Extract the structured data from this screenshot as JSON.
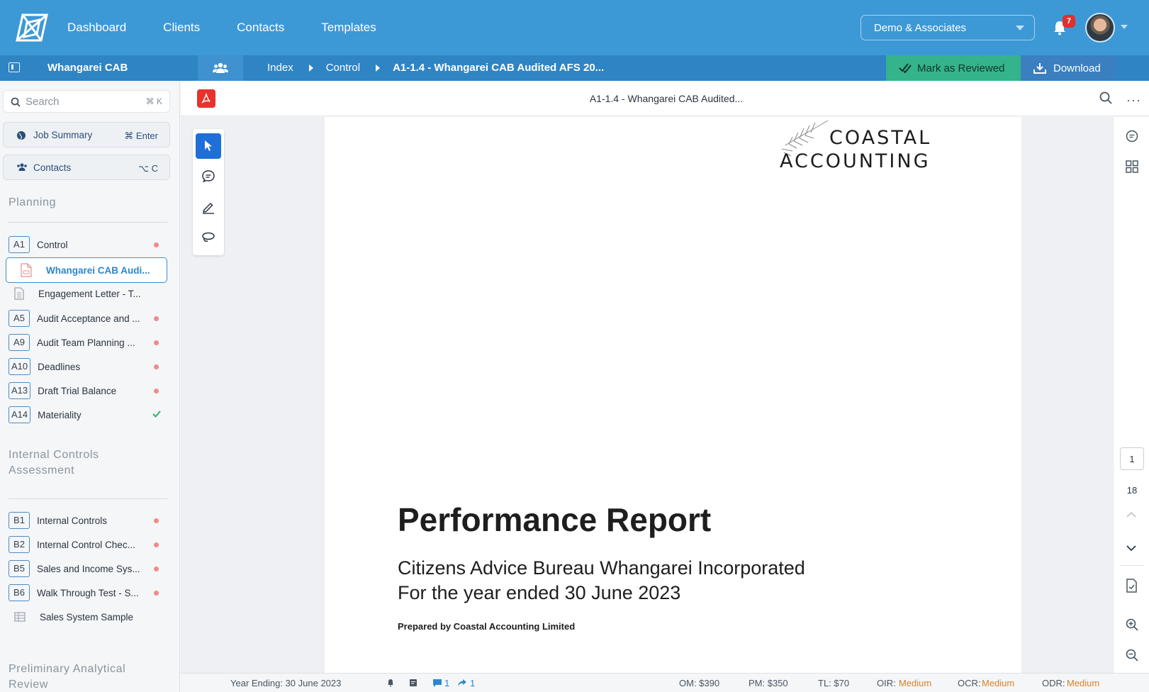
{
  "nav": {
    "items": [
      "Dashboard",
      "Clients",
      "Contacts",
      "Templates"
    ],
    "org_selector": "Demo & Associates",
    "notifications_count": "7"
  },
  "subbar": {
    "client": "Whangarei CAB",
    "breadcrumb": [
      "Index",
      "Control",
      "A1-1.4 - Whangarei CAB Audited AFS 20..."
    ],
    "mark_reviewed": "Mark as Reviewed",
    "download": "Download"
  },
  "sidebar": {
    "search_placeholder": "Search",
    "search_shortcut": "⌘ K",
    "job_summary": {
      "label": "Job Summary",
      "shortcut": "⌘ Enter"
    },
    "contacts": {
      "label": "Contacts",
      "shortcut": "⌥ C"
    },
    "sections": [
      {
        "title": "Planning",
        "items": [
          {
            "code": "A1",
            "label": "Control",
            "status": "pending"
          },
          {
            "code": "",
            "label": "Whangarei CAB Audi...",
            "type": "pdf",
            "active": true
          },
          {
            "code": "",
            "label": "Engagement Letter - T...",
            "type": "doc"
          },
          {
            "code": "A5",
            "label": "Audit Acceptance and ...",
            "status": "pending"
          },
          {
            "code": "A9",
            "label": "Audit Team Planning ...",
            "status": "pending"
          },
          {
            "code": "A10",
            "label": "Deadlines",
            "status": "pending"
          },
          {
            "code": "A13",
            "label": "Draft Trial Balance",
            "status": "pending"
          },
          {
            "code": "A14",
            "label": "Materiality",
            "status": "done"
          }
        ]
      },
      {
        "title": "Internal Controls Assessment",
        "items": [
          {
            "code": "B1",
            "label": "Internal Controls",
            "status": "pending"
          },
          {
            "code": "B2",
            "label": "Internal Control Chec...",
            "status": "pending"
          },
          {
            "code": "B5",
            "label": "Sales and Income Sys...",
            "status": "pending"
          },
          {
            "code": "B6",
            "label": "Walk Through Test - S...",
            "status": "pending"
          },
          {
            "code": "",
            "label": "Sales System Sample",
            "type": "sheet"
          }
        ]
      },
      {
        "title": "Preliminary Analytical Review",
        "items": []
      }
    ]
  },
  "document": {
    "title": "A1-1.4 - Whangarei CAB Audited...",
    "logo_line1": "COASTAL",
    "logo_line2": "ACCOUNTING",
    "heading": "Performance Report",
    "subheading_1": "Citizens Advice Bureau Whangarei Incorporated",
    "subheading_2": "For the year ended 30 June 2023",
    "prepared_by": "Prepared by Coastal Accounting Limited",
    "current_page": "1",
    "total_pages": "18"
  },
  "status_bar": {
    "year_ending": "Year Ending: 30 June 2023",
    "comments": "1",
    "shares": "1",
    "om": "OM: $390",
    "pm": "PM: $350",
    "tl": "TL: $70",
    "oir_label": "OIR:",
    "oir_value": "Medium",
    "ocr_label": "OCR:",
    "ocr_value": "Medium",
    "odr_label": "ODR:",
    "odr_value": "Medium"
  },
  "colors": {
    "topbar": "#3d98d6",
    "subbar": "#2f84c4",
    "reviewed_button": "#35b38b",
    "risk_value": "#d9822b",
    "pending_dot": "#f08a8a",
    "done_check": "#2fb36b"
  }
}
